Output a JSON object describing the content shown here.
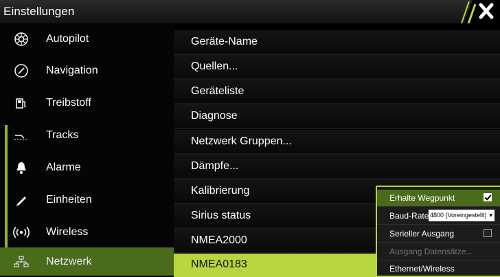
{
  "window": {
    "title": "Einstellungen"
  },
  "sidebar": {
    "items": [
      {
        "label": "Autopilot",
        "icon": "autopilot-helm-icon"
      },
      {
        "label": "Navigation",
        "icon": "compass-icon"
      },
      {
        "label": "Treibstoff",
        "icon": "fuel-pump-icon"
      },
      {
        "label": "Tracks",
        "icon": "tracks-icon"
      },
      {
        "label": "Alarme",
        "icon": "bell-icon"
      },
      {
        "label": "Einheiten",
        "icon": "ruler-pen-icon"
      },
      {
        "label": "Wireless",
        "icon": "wireless-signal-icon"
      },
      {
        "label": "Netzwerk",
        "icon": "network-icon",
        "active": true
      }
    ]
  },
  "content": {
    "items": [
      {
        "label": "Geräte-Name"
      },
      {
        "label": "Quellen..."
      },
      {
        "label": "Geräteliste"
      },
      {
        "label": "Diagnose"
      },
      {
        "label": "Netzwerk Gruppen..."
      },
      {
        "label": "Dämpfe..."
      },
      {
        "label": "Kalibrierung"
      },
      {
        "label": "Sirius status"
      },
      {
        "label": "NMEA2000"
      },
      {
        "label": "NMEA0183",
        "selected": true
      }
    ]
  },
  "popup": {
    "receive_waypoint": {
      "label": "Erhalte Wegpunkt",
      "checked": true
    },
    "baud_rate": {
      "label": "Baud-Rate",
      "value": "4800 (Voreingestellt)"
    },
    "serial_output": {
      "label": "Serieller Ausgang",
      "checked": false
    },
    "output_sentences": {
      "label": "Ausgang Datensätze..."
    },
    "ethernet_wireless": {
      "label": "Ethernet/Wireless"
    }
  },
  "colors": {
    "accent": "#b8d640",
    "active": "#4a6a1c",
    "background": "#000000"
  }
}
